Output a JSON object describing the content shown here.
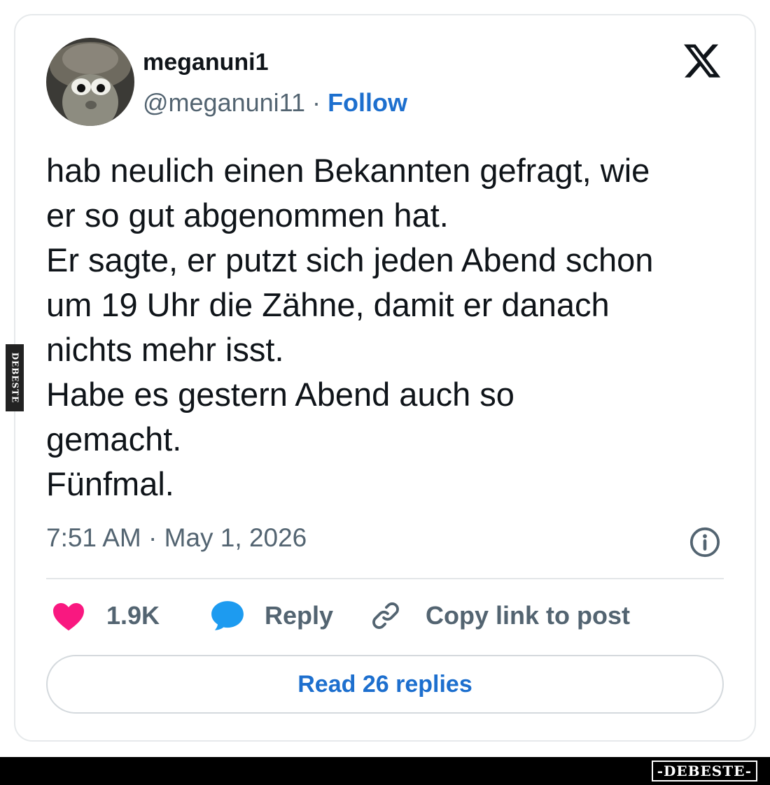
{
  "author": {
    "display_name": "meganuni1",
    "handle": "@meganuni11",
    "separator": "·",
    "follow_label": "Follow"
  },
  "brand_icon": "x-logo-icon",
  "tweet": {
    "lines": [
      "hab neulich einen Bekannten gefragt, wie",
      "er so gut abgenommen hat.",
      "Er sagte, er putzt sich jeden Abend schon",
      "um 19 Uhr die Zähne, damit er danach",
      "nichts mehr isst.",
      "Habe es gestern Abend auch so",
      "gemacht.",
      "Fünfmal."
    ],
    "timestamp": "7:51 AM · May 1, 2026"
  },
  "actions": {
    "likes_count": "1.9K",
    "reply_label": "Reply",
    "copy_link_label": "Copy link to post"
  },
  "read_replies_label": "Read 26 replies",
  "watermark": {
    "side_text": "DEBESTE",
    "logo_text": "-DEBESTE-"
  },
  "colors": {
    "accent_blue": "#1d6fce",
    "heart_pink": "#f91880",
    "reply_blue": "#1d9bf0",
    "text_primary": "#0f1419",
    "text_secondary": "#536471"
  }
}
